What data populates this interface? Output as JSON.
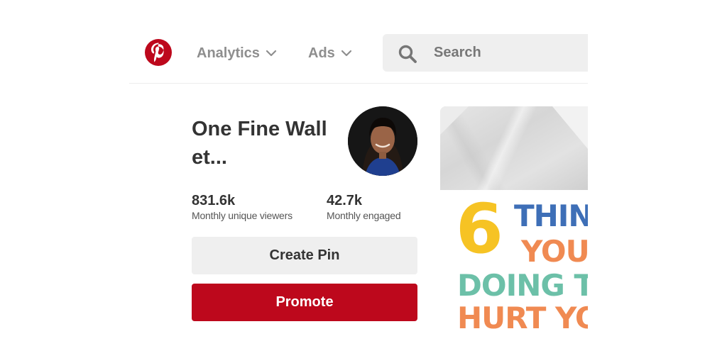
{
  "header": {
    "logo_icon": "pinterest-logo",
    "nav": [
      {
        "label": "Analytics",
        "icon": "chevron-down-icon"
      },
      {
        "label": "Ads",
        "icon": "chevron-down-icon"
      }
    ],
    "search": {
      "placeholder": "Search",
      "value": "",
      "icon": "search-icon"
    }
  },
  "profile": {
    "name_line1": "One Fine Wall",
    "name_line2": "et...",
    "avatar_icon": "avatar",
    "stats": [
      {
        "value": "831.6k",
        "label": "Monthly unique viewers"
      },
      {
        "value": "42.7k",
        "label": "Monthly engaged"
      }
    ]
  },
  "actions": {
    "create_label": "Create Pin",
    "promote_label": "Promote"
  },
  "pin": {
    "number": "6",
    "line1": "THIN",
    "line2": "YOU",
    "line3": "DOING TH",
    "line4": "HURT YO"
  },
  "colors": {
    "brand": "#bd081c",
    "button_gray": "#efefef",
    "text": "#333333",
    "nav_text": "#8e8e8e"
  }
}
